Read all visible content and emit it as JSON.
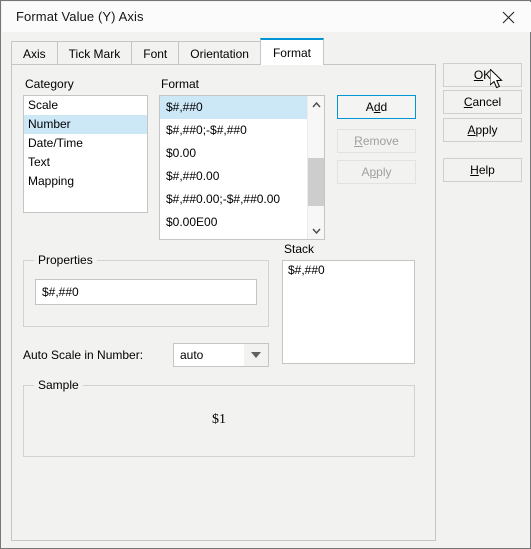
{
  "window": {
    "title": "Format Value (Y) Axis",
    "close_icon": "close-icon"
  },
  "tabs": [
    {
      "label": "Axis",
      "selected": false
    },
    {
      "label": "Tick Mark",
      "selected": false
    },
    {
      "label": "Font",
      "selected": false
    },
    {
      "label": "Orientation",
      "selected": false
    },
    {
      "label": "Format",
      "selected": true
    }
  ],
  "category": {
    "label": "Category",
    "items": [
      {
        "label": "Scale",
        "selected": false
      },
      {
        "label": "Number",
        "selected": true
      },
      {
        "label": "Date/Time",
        "selected": false
      },
      {
        "label": "Text",
        "selected": false
      },
      {
        "label": "Mapping",
        "selected": false
      }
    ]
  },
  "format": {
    "label": "Format",
    "items": [
      {
        "label": "$#,##0",
        "selected": true
      },
      {
        "label": "$#,##0;-$#,##0",
        "selected": false
      },
      {
        "label": "$0.00",
        "selected": false
      },
      {
        "label": "$#,##0.00",
        "selected": false
      },
      {
        "label": "$#,##0.00;-$#,##0.00",
        "selected": false
      },
      {
        "label": "$0.00E00",
        "selected": false
      }
    ],
    "scrollbar": {
      "up_icon": "chevron-up-icon",
      "down_icon": "chevron-down-icon"
    },
    "buttons": {
      "add": {
        "label": "Add",
        "mnemonic": "d",
        "enabled": true,
        "default": true
      },
      "remove": {
        "label": "Remove",
        "mnemonic": "R",
        "enabled": false
      },
      "apply": {
        "label": "Apply",
        "mnemonic": "p",
        "enabled": false
      }
    }
  },
  "stack": {
    "label": "Stack",
    "items": [
      {
        "label": "$#,##0"
      }
    ]
  },
  "properties": {
    "label": "Properties",
    "value": "$#,##0",
    "placeholder": ""
  },
  "auto_scale": {
    "label": "Auto Scale in Number:",
    "value": "auto",
    "options": [
      "auto"
    ],
    "arrow_icon": "chevron-down-icon"
  },
  "sample": {
    "label": "Sample",
    "value": "$1"
  },
  "dialog_buttons": [
    {
      "label": "OK",
      "mnemonic": "O",
      "name": "ok-button"
    },
    {
      "label": "Cancel",
      "mnemonic": "C",
      "name": "cancel-button"
    },
    {
      "label": "Apply",
      "mnemonic": "A",
      "name": "apply-button"
    },
    {
      "label": "Help",
      "mnemonic": "H",
      "name": "help-button"
    }
  ],
  "colors": {
    "accent": "#0096d6",
    "selection": "#cce8f7",
    "dialog_bg": "#f2f2f0",
    "titlebar_bg": "#fbfbfb",
    "border": "#c6c6c6",
    "disabled_text": "#a0a0a0"
  }
}
